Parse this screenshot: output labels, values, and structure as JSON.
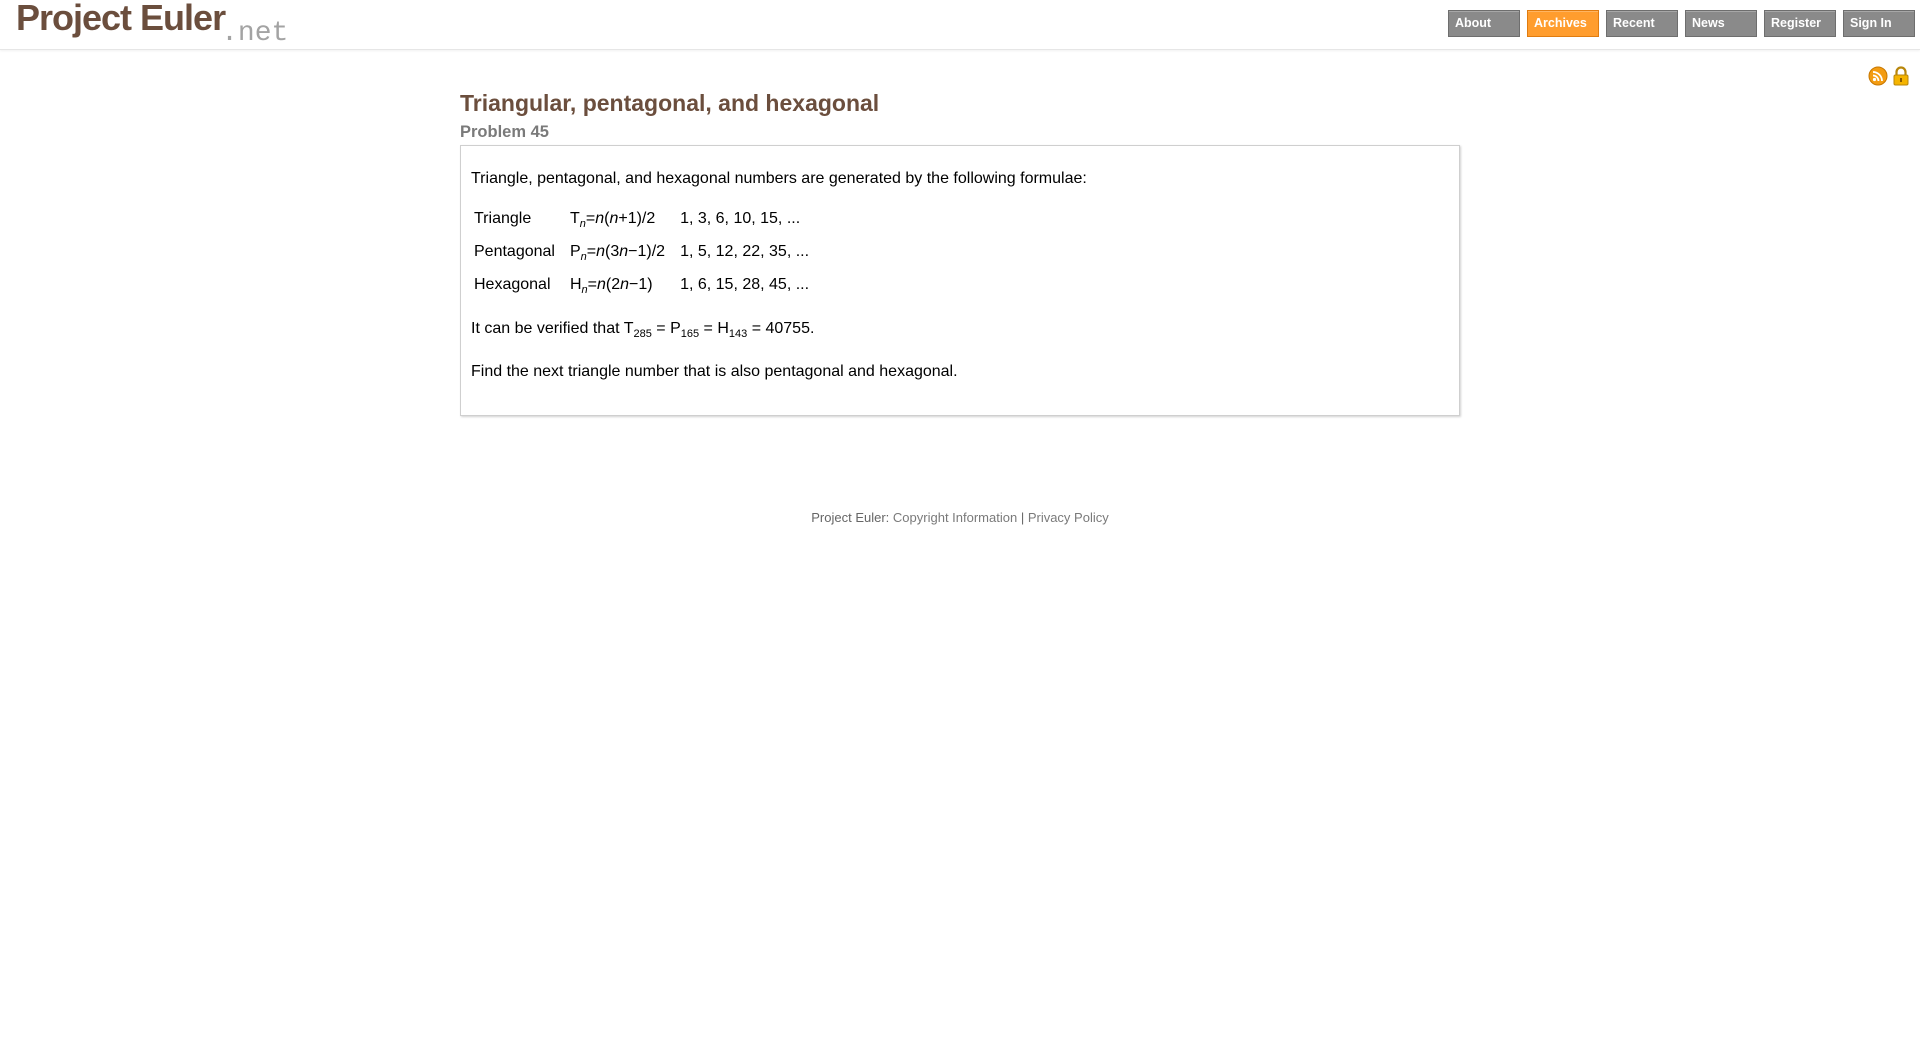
{
  "header": {
    "logo_main": "Project Euler",
    "logo_suffix": ".net",
    "nav": [
      {
        "label": "About",
        "active": false
      },
      {
        "label": "Archives",
        "active": true
      },
      {
        "label": "Recent",
        "active": false
      },
      {
        "label": "News",
        "active": false
      },
      {
        "label": "Register",
        "active": false
      },
      {
        "label": "Sign In",
        "active": false
      }
    ],
    "accent_color": "#ff9d2e",
    "nav_color": "#8a8a8a"
  },
  "icons": [
    "rss-icon",
    "lock-icon"
  ],
  "problem": {
    "title": "Triangular, pentagonal, and hexagonal",
    "number_label": "Problem 45",
    "intro": "Triangle, pentagonal, and hexagonal numbers are generated by the following formulae:",
    "rows": [
      {
        "name": "Triangle",
        "letter": "T",
        "sub": "n",
        "formula_prefix": "=",
        "formula_n": "n",
        "formula_body": "(",
        "formula_n2": "n",
        "formula_tail": "+1)/2",
        "sequence": "1, 3, 6, 10, 15, ..."
      },
      {
        "name": "Pentagonal",
        "letter": "P",
        "sub": "n",
        "formula_prefix": "=",
        "formula_n": "n",
        "formula_body": "(3",
        "formula_n2": "n",
        "formula_tail": "−1)/2",
        "sequence": "1, 5, 12, 22, 35, ..."
      },
      {
        "name": "Hexagonal",
        "letter": "H",
        "sub": "n",
        "formula_prefix": "=",
        "formula_n": "n",
        "formula_body": "(2",
        "formula_n2": "n",
        "formula_tail": "−1)",
        "sequence": "1, 6, 15, 28, 45, ..."
      }
    ],
    "verify": {
      "lead": "It can be verified that T",
      "t_sub": "285",
      "p_text": " = P",
      "p_sub": "165",
      "h_text": " = H",
      "h_sub": "143",
      "tail": " = 40755."
    },
    "question": "Find the next triangle number that is also pentagonal and hexagonal."
  },
  "footer": {
    "prefix": "Project Euler: ",
    "copyright": "Copyright Information",
    "separator": " | ",
    "privacy": "Privacy Policy"
  }
}
